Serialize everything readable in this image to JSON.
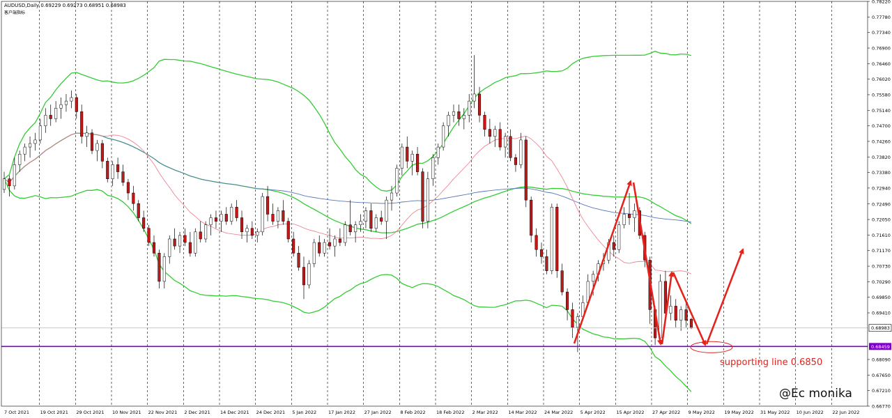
{
  "header": {
    "symbol_line": "AUDUSD,Daily  0.69229 0.69273 0.68951 0.68983",
    "sub_line": "客户端指标"
  },
  "annotation": {
    "text": "supporting line 0.6850"
  },
  "watermark": {
    "text": "@Ec monika"
  },
  "colors": {
    "bull": "#1a1a1a",
    "bear": "#c41818",
    "bb_outer": "#33cc33",
    "ma_blue": "#5577bb",
    "ma_pink": "#ee7788",
    "support": "#7a00c8",
    "arrows": "#e3231c",
    "last_price_label_bg": "#ffffff"
  },
  "chart_data": {
    "type": "candlestick",
    "title": "AUDUSD,Daily",
    "ylim": [
      0.6677,
      0.7822
    ],
    "y_ticks": [
      "0.78220",
      "0.77780",
      "0.77340",
      "0.76900",
      "0.76460",
      "0.76020",
      "0.75580",
      "0.75140",
      "0.74700",
      "0.74260",
      "0.73820",
      "0.73380",
      "0.72940",
      "0.72490",
      "0.72050",
      "0.71610",
      "0.71170",
      "0.70730",
      "0.70290",
      "0.69850",
      "0.69410",
      "0.68983",
      "0.68459",
      "0.68090",
      "0.67650",
      "0.67210",
      "0.66770"
    ],
    "x_ticks": [
      "7 Oct 2021",
      "19 Oct 2021",
      "29 Oct 2021",
      "10 Nov 2021",
      "22 Nov 2021",
      "2 Dec 2021",
      "14 Dec 2021",
      "24 Dec 2021",
      "5 Jan 2022",
      "17 Jan 2022",
      "27 Jan 2022",
      "8 Feb 2022",
      "18 Feb 2022",
      "2 Mar 2022",
      "14 Mar 2022",
      "24 Mar 2022",
      "5 Apr 2022",
      "15 Apr 2022",
      "27 Apr 2022",
      "9 May 2022",
      "19 May 2022",
      "31 May 2022",
      "10 Jun 2022",
      "22 Jun 2022"
    ],
    "last_price": 0.68983,
    "support_level": 0.68459,
    "candles": [
      [
        0.729,
        0.734,
        0.728,
        0.732
      ],
      [
        0.732,
        0.733,
        0.727,
        0.73
      ],
      [
        0.73,
        0.738,
        0.729,
        0.736
      ],
      [
        0.736,
        0.74,
        0.734,
        0.739
      ],
      [
        0.739,
        0.742,
        0.737,
        0.741
      ],
      [
        0.741,
        0.744,
        0.738,
        0.742
      ],
      [
        0.742,
        0.745,
        0.74,
        0.743
      ],
      [
        0.743,
        0.749,
        0.742,
        0.747
      ],
      [
        0.747,
        0.752,
        0.745,
        0.75
      ],
      [
        0.75,
        0.753,
        0.747,
        0.749
      ],
      [
        0.749,
        0.754,
        0.748,
        0.752
      ],
      [
        0.752,
        0.755,
        0.749,
        0.753
      ],
      [
        0.753,
        0.756,
        0.751,
        0.754
      ],
      [
        0.754,
        0.757,
        0.752,
        0.755
      ],
      [
        0.755,
        0.756,
        0.749,
        0.751
      ],
      [
        0.751,
        0.753,
        0.742,
        0.744
      ],
      [
        0.744,
        0.747,
        0.741,
        0.745
      ],
      [
        0.745,
        0.746,
        0.739,
        0.74
      ],
      [
        0.74,
        0.743,
        0.737,
        0.742
      ],
      [
        0.742,
        0.743,
        0.735,
        0.737
      ],
      [
        0.737,
        0.738,
        0.731,
        0.732
      ],
      [
        0.732,
        0.737,
        0.73,
        0.736
      ],
      [
        0.736,
        0.738,
        0.732,
        0.734
      ],
      [
        0.734,
        0.736,
        0.73,
        0.731
      ],
      [
        0.731,
        0.732,
        0.726,
        0.728
      ],
      [
        0.728,
        0.73,
        0.723,
        0.725
      ],
      [
        0.725,
        0.726,
        0.72,
        0.721
      ],
      [
        0.721,
        0.723,
        0.717,
        0.718
      ],
      [
        0.718,
        0.719,
        0.713,
        0.714
      ],
      [
        0.714,
        0.716,
        0.71,
        0.711
      ],
      [
        0.711,
        0.712,
        0.701,
        0.703
      ],
      [
        0.703,
        0.711,
        0.701,
        0.71
      ],
      [
        0.71,
        0.716,
        0.708,
        0.715
      ],
      [
        0.715,
        0.718,
        0.712,
        0.713
      ],
      [
        0.713,
        0.717,
        0.711,
        0.716
      ],
      [
        0.716,
        0.718,
        0.713,
        0.714
      ],
      [
        0.714,
        0.717,
        0.71,
        0.711
      ],
      [
        0.711,
        0.718,
        0.71,
        0.717
      ],
      [
        0.717,
        0.72,
        0.714,
        0.715
      ],
      [
        0.715,
        0.72,
        0.714,
        0.719
      ],
      [
        0.719,
        0.722,
        0.716,
        0.721
      ],
      [
        0.721,
        0.723,
        0.718,
        0.72
      ],
      [
        0.72,
        0.723,
        0.717,
        0.722
      ],
      [
        0.722,
        0.724,
        0.719,
        0.72
      ],
      [
        0.72,
        0.725,
        0.719,
        0.724
      ],
      [
        0.724,
        0.726,
        0.72,
        0.721
      ],
      [
        0.721,
        0.723,
        0.715,
        0.717
      ],
      [
        0.717,
        0.719,
        0.714,
        0.718
      ],
      [
        0.718,
        0.72,
        0.715,
        0.716
      ],
      [
        0.716,
        0.718,
        0.714,
        0.717
      ],
      [
        0.717,
        0.728,
        0.716,
        0.727
      ],
      [
        0.727,
        0.73,
        0.72,
        0.722
      ],
      [
        0.722,
        0.725,
        0.719,
        0.72
      ],
      [
        0.72,
        0.724,
        0.718,
        0.723
      ],
      [
        0.723,
        0.726,
        0.719,
        0.72
      ],
      [
        0.72,
        0.721,
        0.714,
        0.715
      ],
      [
        0.715,
        0.717,
        0.71,
        0.711
      ],
      [
        0.711,
        0.713,
        0.706,
        0.707
      ],
      [
        0.707,
        0.71,
        0.698,
        0.702
      ],
      [
        0.702,
        0.709,
        0.701,
        0.708
      ],
      [
        0.708,
        0.715,
        0.707,
        0.714
      ],
      [
        0.714,
        0.716,
        0.71,
        0.711
      ],
      [
        0.711,
        0.715,
        0.71,
        0.714
      ],
      [
        0.714,
        0.718,
        0.712,
        0.713
      ],
      [
        0.713,
        0.716,
        0.71,
        0.715
      ],
      [
        0.715,
        0.718,
        0.713,
        0.714
      ],
      [
        0.714,
        0.72,
        0.713,
        0.719
      ],
      [
        0.719,
        0.726,
        0.716,
        0.717
      ],
      [
        0.717,
        0.72,
        0.714,
        0.719
      ],
      [
        0.719,
        0.722,
        0.717,
        0.72
      ],
      [
        0.72,
        0.724,
        0.718,
        0.723
      ],
      [
        0.723,
        0.725,
        0.717,
        0.718
      ],
      [
        0.718,
        0.722,
        0.717,
        0.721
      ],
      [
        0.721,
        0.723,
        0.719,
        0.72
      ],
      [
        0.72,
        0.727,
        0.715,
        0.726
      ],
      [
        0.726,
        0.73,
        0.723,
        0.728
      ],
      [
        0.728,
        0.736,
        0.727,
        0.735
      ],
      [
        0.735,
        0.742,
        0.733,
        0.741
      ],
      [
        0.741,
        0.744,
        0.735,
        0.737
      ],
      [
        0.737,
        0.74,
        0.733,
        0.739
      ],
      [
        0.739,
        0.741,
        0.733,
        0.734
      ],
      [
        0.734,
        0.735,
        0.718,
        0.72
      ],
      [
        0.72,
        0.734,
        0.718,
        0.732
      ],
      [
        0.732,
        0.739,
        0.73,
        0.738
      ],
      [
        0.738,
        0.742,
        0.736,
        0.741
      ],
      [
        0.741,
        0.748,
        0.74,
        0.747
      ],
      [
        0.747,
        0.751,
        0.744,
        0.75
      ],
      [
        0.75,
        0.753,
        0.748,
        0.751
      ],
      [
        0.751,
        0.753,
        0.747,
        0.749
      ],
      [
        0.749,
        0.752,
        0.746,
        0.75
      ],
      [
        0.75,
        0.756,
        0.748,
        0.754
      ],
      [
        0.754,
        0.767,
        0.752,
        0.756
      ],
      [
        0.756,
        0.758,
        0.748,
        0.75
      ],
      [
        0.75,
        0.751,
        0.744,
        0.746
      ],
      [
        0.746,
        0.749,
        0.742,
        0.744
      ],
      [
        0.744,
        0.747,
        0.741,
        0.746
      ],
      [
        0.746,
        0.748,
        0.74,
        0.741
      ],
      [
        0.741,
        0.745,
        0.738,
        0.744
      ],
      [
        0.744,
        0.746,
        0.737,
        0.738
      ],
      [
        0.738,
        0.739,
        0.734,
        0.736
      ],
      [
        0.736,
        0.745,
        0.735,
        0.743
      ],
      [
        0.743,
        0.744,
        0.724,
        0.726
      ],
      [
        0.726,
        0.727,
        0.714,
        0.716
      ],
      [
        0.716,
        0.718,
        0.71,
        0.712
      ],
      [
        0.712,
        0.714,
        0.708,
        0.71
      ],
      [
        0.71,
        0.712,
        0.705,
        0.706
      ],
      [
        0.706,
        0.725,
        0.705,
        0.724
      ],
      [
        0.724,
        0.725,
        0.704,
        0.706
      ],
      [
        0.706,
        0.708,
        0.699,
        0.7
      ],
      [
        0.7,
        0.701,
        0.692,
        0.695
      ],
      [
        0.695,
        0.697,
        0.687,
        0.69
      ],
      [
        0.69,
        0.694,
        0.683,
        0.693
      ],
      [
        0.693,
        0.699,
        0.692,
        0.697
      ],
      [
        0.697,
        0.705,
        0.696,
        0.703
      ],
      [
        0.703,
        0.706,
        0.699,
        0.705
      ],
      [
        0.705,
        0.709,
        0.703,
        0.708
      ],
      [
        0.708,
        0.711,
        0.706,
        0.709
      ],
      [
        0.709,
        0.715,
        0.708,
        0.714
      ],
      [
        0.714,
        0.716,
        0.71,
        0.712
      ],
      [
        0.712,
        0.72,
        0.711,
        0.719
      ],
      [
        0.719,
        0.724,
        0.718,
        0.722
      ],
      [
        0.722,
        0.728,
        0.719,
        0.721
      ],
      [
        0.721,
        0.725,
        0.717,
        0.723
      ],
      [
        0.723,
        0.724,
        0.715,
        0.716
      ],
      [
        0.716,
        0.717,
        0.707,
        0.709
      ],
      [
        0.709,
        0.71,
        0.691,
        0.695
      ],
      [
        0.695,
        0.696,
        0.685,
        0.687
      ],
      [
        0.687,
        0.705,
        0.686,
        0.703
      ],
      [
        0.703,
        0.706,
        0.692,
        0.694
      ],
      [
        0.694,
        0.699,
        0.692,
        0.696
      ],
      [
        0.696,
        0.698,
        0.69,
        0.692
      ],
      [
        0.692,
        0.696,
        0.689,
        0.695
      ],
      [
        0.695,
        0.697,
        0.69,
        0.692
      ],
      [
        0.6923,
        0.6927,
        0.6895,
        0.6898
      ]
    ]
  }
}
